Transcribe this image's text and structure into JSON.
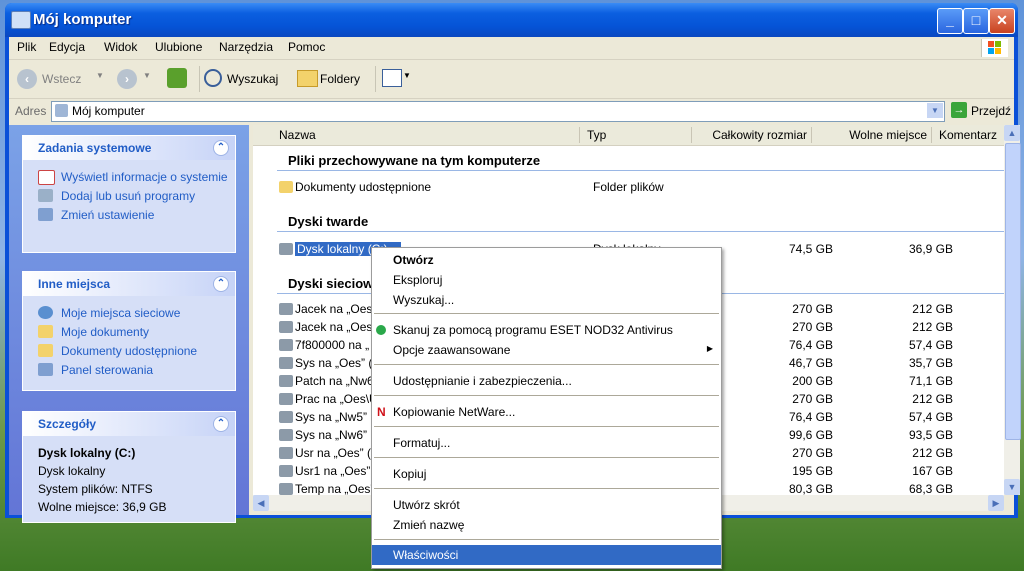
{
  "window": {
    "title": "Mój komputer"
  },
  "menu": [
    "Plik",
    "Edycja",
    "Widok",
    "Ulubione",
    "Narzędzia",
    "Pomoc"
  ],
  "toolbar": {
    "back": "Wstecz",
    "search": "Wyszukaj",
    "folders": "Foldery"
  },
  "address": {
    "label": "Adres",
    "value": "Mój komputer",
    "go": "Przejdź"
  },
  "left_panel": {
    "system_tasks": {
      "title": "Zadania systemowe",
      "items": [
        "Wyświetl informacje o systemie",
        "Dodaj lub usuń programy",
        "Zmień ustawienie"
      ]
    },
    "other_places": {
      "title": "Inne miejsca",
      "items": [
        "Moje miejsca sieciowe",
        "Moje dokumenty",
        "Dokumenty udostępnione",
        "Panel sterowania"
      ]
    },
    "details": {
      "title": "Szczegóły",
      "name": "Dysk lokalny (C:)",
      "type": "Dysk lokalny",
      "fs": "System plików: NTFS",
      "free": "Wolne miejsce: 36,9 GB"
    }
  },
  "columns": [
    "Nazwa",
    "Typ",
    "Całkowity rozmiar",
    "Wolne miejsce",
    "Komentarz"
  ],
  "groups": {
    "stored": "Pliki przechowywane na tym komputerze",
    "hard": "Dyski twarde",
    "network": "Dyski sieciowe"
  },
  "stored_items": [
    {
      "name": "Dokumenty udostępnione",
      "type": "Folder plików"
    }
  ],
  "hard_drives": [
    {
      "name": "Dysk lokalny (C:)",
      "type": "Dysk lokalny",
      "total": "74,5 GB",
      "free": "36,9 GB"
    }
  ],
  "network_drives": [
    {
      "name": "Jacek na „Oes\\",
      "total": "270 GB",
      "free": "212 GB"
    },
    {
      "name": "Jacek na „Oes\\",
      "total": "270 GB",
      "free": "212 GB"
    },
    {
      "name": "7f800000 na „",
      "total": "76,4 GB",
      "free": "57,4 GB"
    },
    {
      "name": "Sys na „Oes” (",
      "total": "46,7 GB",
      "free": "35,7 GB"
    },
    {
      "name": "Patch na „Nw6",
      "total": "200 GB",
      "free": "71,1 GB"
    },
    {
      "name": "Prac na „Oes\\U",
      "total": "270 GB",
      "free": "212 GB"
    },
    {
      "name": "Sys na „Nw5”",
      "total": "76,4 GB",
      "free": "57,4 GB"
    },
    {
      "name": "Sys na „Nw6”",
      "total": "99,6 GB",
      "free": "93,5 GB"
    },
    {
      "name": "Usr na „Oes” (",
      "total": "270 GB",
      "free": "212 GB"
    },
    {
      "name": "Usr1 na „Oes”",
      "total": "195 GB",
      "free": "167 GB"
    },
    {
      "name": "Temp na „Oes”",
      "total": "80,3 GB",
      "free": "68,3 GB"
    }
  ],
  "context_menu": [
    "Otwórz",
    "Eksploruj",
    "Wyszukaj...",
    "Skanuj za pomocą programu ESET NOD32 Antivirus",
    "Opcje zaawansowane",
    "Udostępnianie i zabezpieczenia...",
    "Kopiowanie NetWare...",
    "Formatuj...",
    "Kopiuj",
    "Utwórz skrót",
    "Zmień nazwę",
    "Właściwości"
  ],
  "colors": {
    "selection": "#316ac5",
    "task_link": "#215dc6",
    "title_bar": "#0553d6"
  }
}
